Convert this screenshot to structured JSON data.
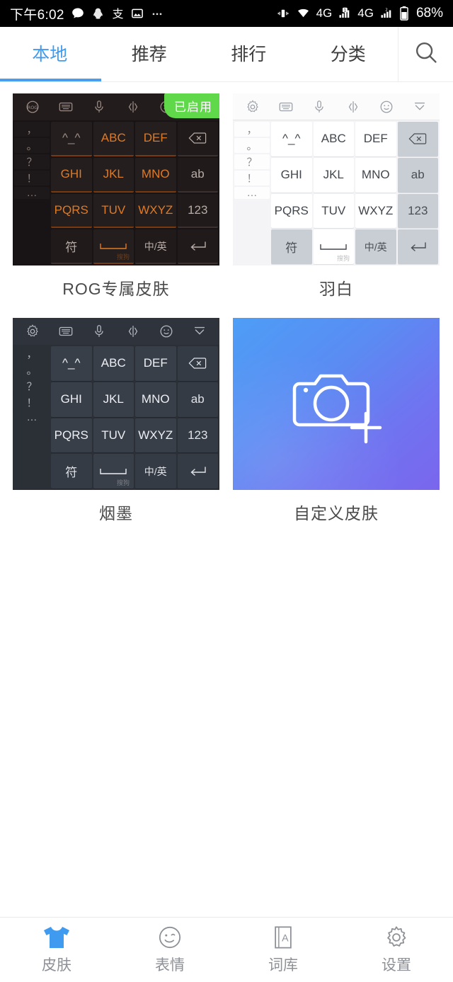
{
  "statusbar": {
    "time": "下午6:02",
    "left_icons": [
      "message-icon",
      "qq-icon",
      "alipay-icon",
      "gallery-icon",
      "more-icon"
    ],
    "right_icons": [
      "vibrate-icon",
      "wifi-icon",
      "signal-4g-icon",
      "sim1-signal-icon",
      "signal-4g-2-icon",
      "sim2-signal-icon",
      "battery-icon"
    ],
    "network_label_1": "4G",
    "network_label_2": "4G",
    "battery_percent": "68%"
  },
  "tabs": [
    {
      "label": "本地",
      "active": true
    },
    {
      "label": "推荐",
      "active": false
    },
    {
      "label": "排行",
      "active": false
    },
    {
      "label": "分类",
      "active": false
    }
  ],
  "search": {
    "icon": "search-icon"
  },
  "colors": {
    "accent": "#3e9bf0",
    "tab_underline": "#4a9ded",
    "badge_green": "#5fd84a",
    "nav_active": "#3e9bf0",
    "nav_label": "#8d9197"
  },
  "skins": [
    {
      "name": "ROG专属皮肤",
      "theme": "rog",
      "badge": "已启用",
      "enabled": true,
      "toolbar_icons": [
        "rog-logo-icon",
        "keyboard-icon",
        "mic-icon",
        "cursor-move-icon",
        "emoji-icon",
        "collapse-icon"
      ],
      "punct_keys": [
        "，",
        "。",
        "？",
        "！",
        "…"
      ],
      "keys": [
        {
          "label": "^_^",
          "type": "face"
        },
        {
          "label": "ABC",
          "type": "letter"
        },
        {
          "label": "DEF",
          "type": "letter"
        },
        {
          "label": "⌫",
          "type": "fn",
          "icon": "backspace-icon"
        },
        {
          "label": "GHI",
          "type": "letter"
        },
        {
          "label": "JKL",
          "type": "letter"
        },
        {
          "label": "MNO",
          "type": "letter"
        },
        {
          "label": "ab",
          "type": "fn"
        },
        {
          "label": "PQRS",
          "type": "letter"
        },
        {
          "label": "TUV",
          "type": "letter"
        },
        {
          "label": "WXYZ",
          "type": "letter"
        },
        {
          "label": "123",
          "type": "fn"
        },
        {
          "label": "符",
          "type": "fn"
        },
        {
          "label": "␣",
          "type": "space",
          "watermark": "搜狗"
        },
        {
          "label": "中/英",
          "type": "fn"
        },
        {
          "label": "↵",
          "type": "fn",
          "icon": "enter-icon"
        }
      ]
    },
    {
      "name": "羽白",
      "theme": "white",
      "badge": null,
      "enabled": false,
      "toolbar_icons": [
        "gear-icon",
        "keyboard-icon",
        "mic-icon",
        "cursor-move-icon",
        "emoji-icon",
        "collapse-icon"
      ],
      "punct_keys": [
        "，",
        "。",
        "？",
        "！",
        "…"
      ],
      "keys": [
        {
          "label": "^_^",
          "type": "face"
        },
        {
          "label": "ABC",
          "type": "letter"
        },
        {
          "label": "DEF",
          "type": "letter"
        },
        {
          "label": "⌫",
          "type": "fn",
          "icon": "backspace-icon"
        },
        {
          "label": "GHI",
          "type": "letter"
        },
        {
          "label": "JKL",
          "type": "letter"
        },
        {
          "label": "MNO",
          "type": "letter"
        },
        {
          "label": "ab",
          "type": "fn"
        },
        {
          "label": "PQRS",
          "type": "letter"
        },
        {
          "label": "TUV",
          "type": "letter"
        },
        {
          "label": "WXYZ",
          "type": "letter"
        },
        {
          "label": "123",
          "type": "fn"
        },
        {
          "label": "符",
          "type": "fn"
        },
        {
          "label": "␣",
          "type": "space",
          "watermark": "搜狗"
        },
        {
          "label": "中/英",
          "type": "fn"
        },
        {
          "label": "↵",
          "type": "fn",
          "icon": "enter-icon"
        }
      ]
    },
    {
      "name": "烟墨",
      "theme": "ink",
      "badge": null,
      "enabled": false,
      "toolbar_icons": [
        "gear-icon",
        "keyboard-icon",
        "mic-icon",
        "cursor-move-icon",
        "emoji-icon",
        "collapse-icon"
      ],
      "punct_keys": [
        "，",
        "。",
        "？",
        "！",
        "…"
      ],
      "keys": [
        {
          "label": "^_^",
          "type": "face"
        },
        {
          "label": "ABC",
          "type": "letter"
        },
        {
          "label": "DEF",
          "type": "letter"
        },
        {
          "label": "⌫",
          "type": "fn",
          "icon": "backspace-icon"
        },
        {
          "label": "GHI",
          "type": "letter"
        },
        {
          "label": "JKL",
          "type": "letter"
        },
        {
          "label": "MNO",
          "type": "letter"
        },
        {
          "label": "ab",
          "type": "fn"
        },
        {
          "label": "PQRS",
          "type": "letter"
        },
        {
          "label": "TUV",
          "type": "letter"
        },
        {
          "label": "WXYZ",
          "type": "letter"
        },
        {
          "label": "123",
          "type": "fn"
        },
        {
          "label": "符",
          "type": "fn"
        },
        {
          "label": "␣",
          "type": "space",
          "watermark": "搜狗"
        },
        {
          "label": "中/英",
          "type": "fn"
        },
        {
          "label": "↵",
          "type": "fn",
          "icon": "enter-icon"
        }
      ]
    },
    {
      "name": "自定义皮肤",
      "theme": "custom",
      "badge": null,
      "enabled": false,
      "icon": "camera-add-icon"
    }
  ],
  "bottom_nav": [
    {
      "label": "皮肤",
      "icon": "tshirt-icon",
      "active": true
    },
    {
      "label": "表情",
      "icon": "smiley-icon",
      "active": false
    },
    {
      "label": "词库",
      "icon": "dictionary-icon",
      "active": false
    },
    {
      "label": "设置",
      "icon": "gear-icon",
      "active": false
    }
  ]
}
